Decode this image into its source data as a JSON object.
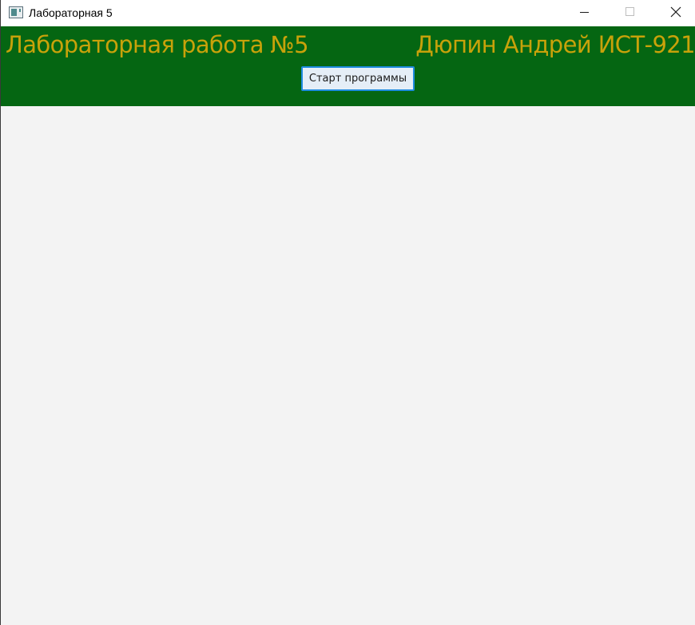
{
  "window": {
    "title": "Лабораторная 5",
    "icon": "application-window-icon",
    "controls": {
      "minimize": "minimize-icon",
      "maximize": "maximize-icon",
      "close": "close-icon"
    }
  },
  "header": {
    "title": "Лабораторная работа №5",
    "author": "Дюпин Андрей ИСТ-921",
    "start_button_label": "Старт программы"
  },
  "colors": {
    "header_background": "#056612",
    "header_text": "#c8a20a",
    "button_border": "#1f8ce0",
    "content_background": "#f3f3f3"
  }
}
